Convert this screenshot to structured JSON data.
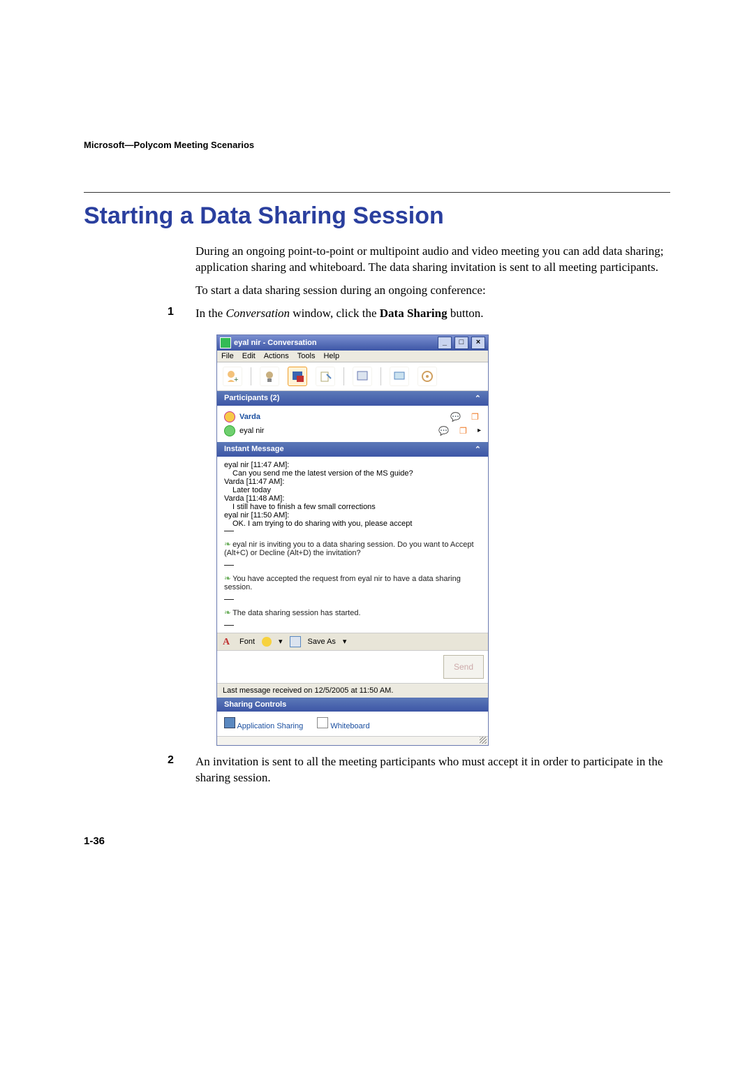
{
  "header": "Microsoft—Polycom Meeting Scenarios",
  "title": "Starting a Data Sharing Session",
  "para1": "During an ongoing point-to-point or multipoint audio and video meeting you can add data sharing; application sharing and whiteboard. The data sharing invitation is sent to all meeting participants.",
  "para2": "To start a data sharing session during an ongoing conference:",
  "step1_prefix": "In the ",
  "step1_italic": "Conversation",
  "step1_mid": " window, click the ",
  "step1_bold": "Data Sharing",
  "step1_suffix": " button.",
  "step2": "An invitation is sent to all the meeting participants who must accept it in order to participate in the sharing session.",
  "page_num": "1-36",
  "win": {
    "title": "eyal nir - Conversation",
    "btn_min": "_",
    "btn_max": "□",
    "btn_close": "×",
    "menu": {
      "file": "File",
      "edit": "Edit",
      "actions": "Actions",
      "tools": "Tools",
      "help": "Help"
    },
    "participants_head": "Participants (2)",
    "p1": "Varda",
    "p2": "eyal nir",
    "im_head": "Instant Message",
    "m1a": "eyal nir [11:47 AM]:",
    "m1b": "Can you send me the latest version of the MS guide?",
    "m2a": "Varda [11:47 AM]:",
    "m2b": "Later today",
    "m3a": "Varda [11:48 AM]:",
    "m3b": "I still have to finish a few small corrections",
    "m4a": "eyal nir [11:50 AM]:",
    "m4b": "OK. I am trying to do sharing with you, please accept",
    "s1": "eyal nir is inviting you to a data sharing session. Do you want to Accept (Alt+C) or Decline (Alt+D) the invitation?",
    "s2": "You have accepted the request from eyal nir to have a data sharing session.",
    "s3": "The data sharing session has started.",
    "font_label": "Font",
    "saveas_label": "Save As",
    "drop": "▾",
    "send": "Send",
    "statusbar": "Last message received on 12/5/2005 at 11:50 AM.",
    "sharing_head": "Sharing Controls",
    "appshare": "Application Sharing",
    "whiteboard": "Whiteboard"
  }
}
